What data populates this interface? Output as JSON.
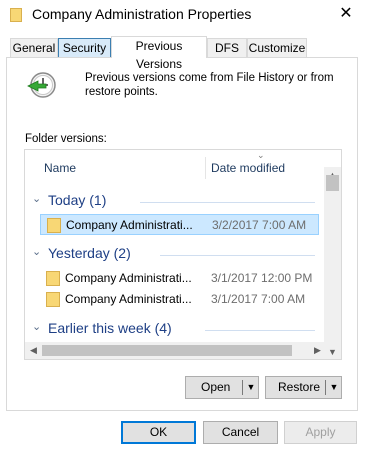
{
  "window": {
    "title": "Company Administration Properties",
    "close_glyph": "✕"
  },
  "tabs": [
    {
      "label": "General"
    },
    {
      "label": "Security"
    },
    {
      "label": "Previous Versions"
    },
    {
      "label": "DFS"
    },
    {
      "label": "Customize"
    }
  ],
  "description": "Previous versions come from File History or from restore points.",
  "folder_versions_label": "Folder versions:",
  "columns": {
    "name": "Name",
    "date": "Date modified"
  },
  "groups": [
    {
      "label": "Today (1)",
      "rows": [
        {
          "name": "Company Administrati...",
          "date": "3/2/2017 7:00 AM",
          "selected": true
        }
      ]
    },
    {
      "label": "Yesterday (2)",
      "rows": [
        {
          "name": "Company Administrati...",
          "date": "3/1/2017 12:00 PM",
          "selected": false
        },
        {
          "name": "Company Administrati...",
          "date": "3/1/2017 7:00 AM",
          "selected": false
        }
      ]
    },
    {
      "label": "Earlier this week (4)",
      "rows": []
    }
  ],
  "buttons": {
    "open": "Open",
    "restore": "Restore",
    "ok": "OK",
    "cancel": "Cancel",
    "apply": "Apply"
  },
  "icons": {
    "window": "folder-icon",
    "history": "clock-restore-icon",
    "file": "folder-icon",
    "dropdown": "▼",
    "up": "▲",
    "down": "▼",
    "left": "◀",
    "right": "▶"
  },
  "colors": {
    "accent": "#0078d7",
    "group_text": "#1e3f85",
    "selection": "#cce8ff"
  }
}
